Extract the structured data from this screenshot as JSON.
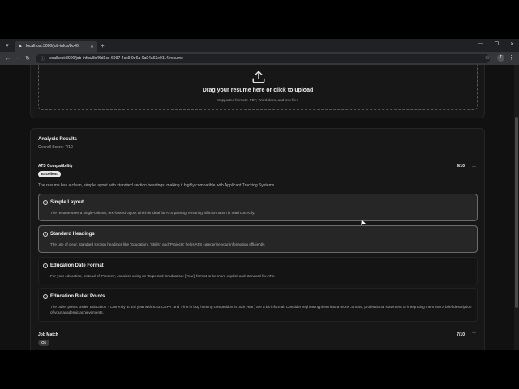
{
  "browser": {
    "tab_title": "localhost:3000/job-infos/8c46",
    "url": "localhost:3000/job-infos/8c46d1cc-6997-4cc9-9e6a-0a94a63e0114/resume",
    "profile_initial": "T"
  },
  "upload": {
    "title": "Drag your resume here or click to upload",
    "subtitle": "Supported formats: PDF, Word docs, and text files"
  },
  "analysis": {
    "title": "Analysis Results",
    "overall": "Overall Score: 7/10"
  },
  "ats": {
    "title": "ATS Compatibility",
    "score": "9/10",
    "badge": "Excellent",
    "description": "The resume has a clean, simple layout with standard section headings, making it highly compatible with Applicant Tracking Systems.",
    "items": [
      {
        "title": "Simple Layout",
        "desc": "The resume uses a single-column, text-based layout which is ideal for ATS parsing, ensuring all information is read correctly."
      },
      {
        "title": "Standard Headings",
        "desc": "The use of clear, standard section headings like 'Education', 'Skills', and 'Projects' helps ATS categorize your information efficiently."
      },
      {
        "title": "Education Date Format",
        "desc": "For your education, instead of 'Present', consider using an 'Expected Graduation: [Year]' format to be more explicit and standard for ATS."
      },
      {
        "title": "Education Bullet Points",
        "desc": "The bullet points under 'Education' ('Currently at 3rd year with 8.53 CGPA' and 'First in bug hunting competition in both year') are a bit informal. Consider rephrasing them into a more concise, professional statement or integrating them into a brief description of your academic achievements."
      }
    ]
  },
  "job_match": {
    "title": "Job Match",
    "score": "7/10",
    "badge": "Ok"
  }
}
